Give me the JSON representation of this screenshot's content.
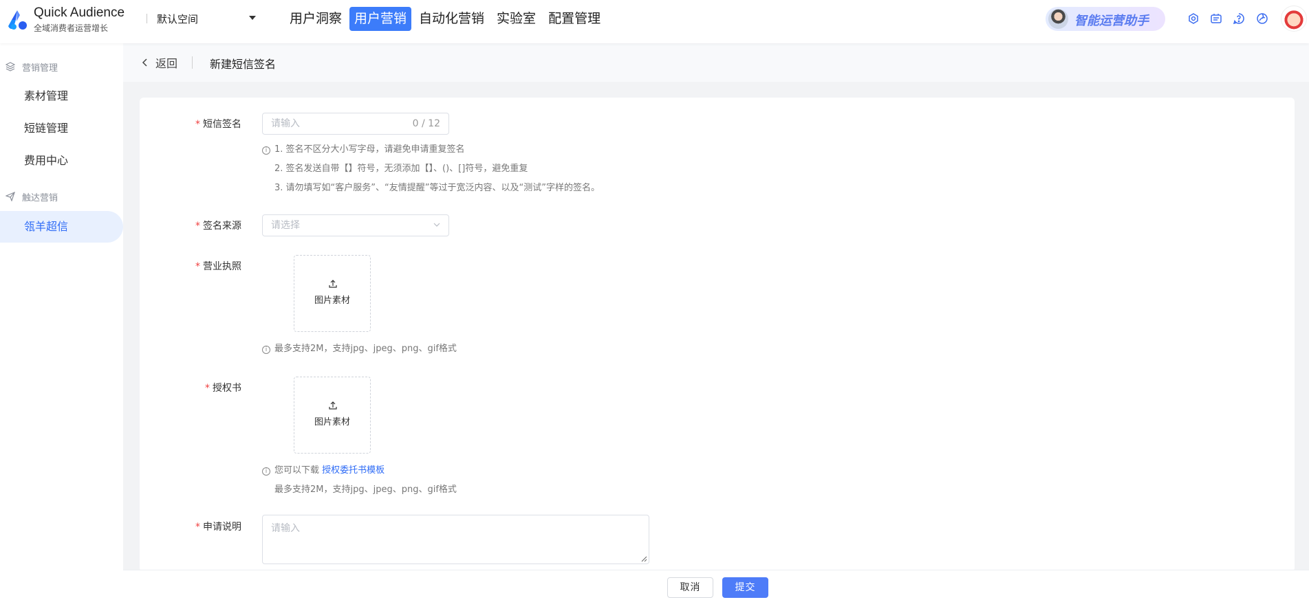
{
  "header": {
    "brand_title": "Quick Audience",
    "brand_subtitle": "全域消费者运营增长",
    "workspace": "默认空间",
    "nav": [
      "用户洞察",
      "用户营销",
      "自动化营销",
      "实验室",
      "配置管理"
    ],
    "active_nav": "用户营销",
    "assistant_label": "智能运营助手",
    "icons": [
      "app-icon",
      "message-icon",
      "help-icon",
      "theme-icon"
    ]
  },
  "sidebar": {
    "group1": "营销管理",
    "group1_items": [
      "素材管理",
      "短链管理",
      "费用中心"
    ],
    "group2": "触达营销",
    "group2_items": [
      "瓴羊超信"
    ],
    "active_item": "瓴羊超信"
  },
  "subheader": {
    "back_label": "返回",
    "title": "新建短信签名"
  },
  "form": {
    "signature": {
      "label": "短信签名",
      "placeholder": "请输入",
      "counter": "0 / 12",
      "hints": [
        "1. 签名不区分大小写字母，请避免申请重复签名",
        "2. 签名发送自带【】符号，无须添加【】、()、[]符号，避免重复",
        "3. 请勿填写如“客户服务”、“友情提醒”等过于宽泛内容、以及“测试”字样的签名。"
      ]
    },
    "source": {
      "label": "签名来源",
      "placeholder": "请选择"
    },
    "license": {
      "label": "营业执照",
      "upload_label": "图片素材",
      "hint": "最多支持2M，支持jpg、jpeg、png、gif格式"
    },
    "authorization": {
      "label": "授权书",
      "upload_label": "图片素材",
      "hint_prefix": "您可以下载",
      "hint_link": "授权委托书模板",
      "hint2": "最多支持2M，支持jpg、jpeg、png、gif格式"
    },
    "description": {
      "label": "申请说明",
      "placeholder": "请输入"
    }
  },
  "footer": {
    "cancel_label": "取消",
    "submit_label": "提交"
  },
  "colors": {
    "accent": "#3c7cfa",
    "required": "#f04040",
    "link": "#2f6cf6"
  }
}
